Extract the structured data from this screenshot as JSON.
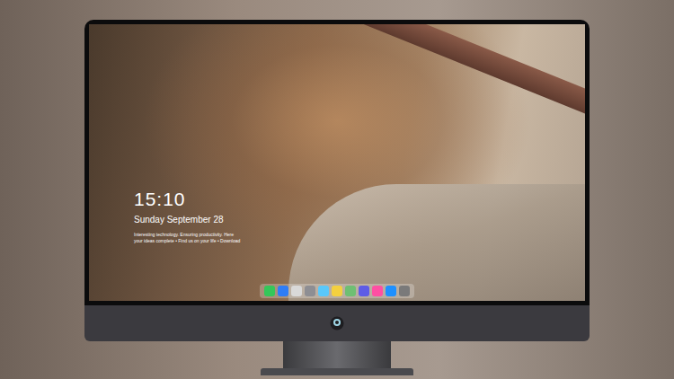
{
  "lock_screen": {
    "time": "15:10",
    "date": "Sunday September 28",
    "caption_lines": [
      "Interesting technology. Ensuring productivity. Here",
      "your ideas complete • Find us on your life • Download"
    ]
  },
  "dock": {
    "items": [
      {
        "color": "#34c759"
      },
      {
        "color": "#2f7df6"
      },
      {
        "color": "#d9d9d9"
      },
      {
        "color": "#8e8e93"
      },
      {
        "color": "#5ac8fa"
      },
      {
        "color": "#f4d03f"
      },
      {
        "color": "#6fbf73"
      },
      {
        "color": "#5e5ce6"
      },
      {
        "color": "#ff4fa3"
      },
      {
        "color": "#1e90ff"
      },
      {
        "color": "#7a7a7a"
      }
    ]
  }
}
